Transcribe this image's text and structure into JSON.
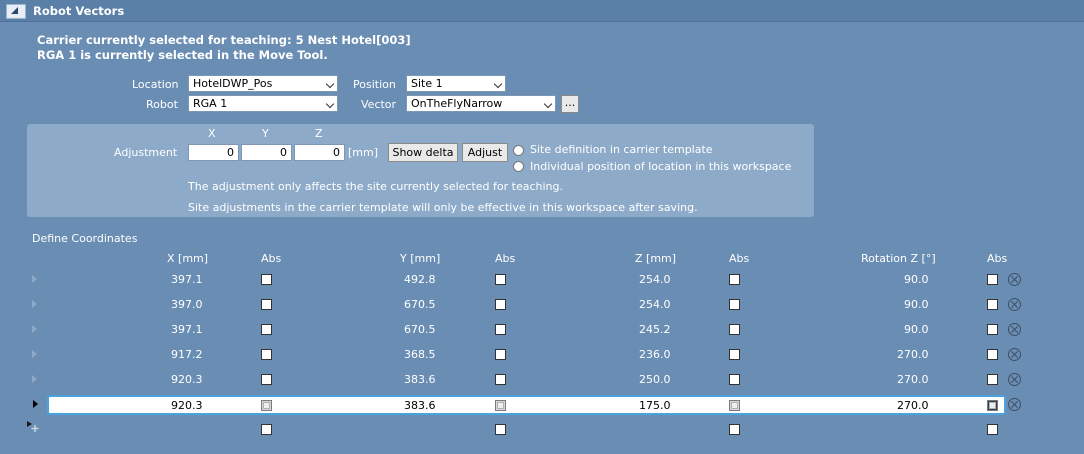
{
  "panel": {
    "title": "Robot Vectors"
  },
  "status": {
    "line1": "Carrier currently selected for teaching: 5 Nest Hotel[003]",
    "line2": "RGA 1 is currently selected in the Move Tool."
  },
  "form": {
    "location_label": "Location",
    "location_value": "HotelDWP_Pos",
    "position_label": "Position",
    "position_value": "Site 1",
    "robot_label": "Robot",
    "robot_value": "RGA 1",
    "vector_label": "Vector",
    "vector_value": "OnTheFlyNarrow",
    "browse_label": "..."
  },
  "adjustment": {
    "label": "Adjustment",
    "x_head": "X",
    "y_head": "Y",
    "z_head": "Z",
    "x_value": "0",
    "y_value": "0",
    "z_value": "0",
    "unit": "[mm]",
    "show_delta_label": "Show delta",
    "adjust_label": "Adjust",
    "radio1_label": "Site definition in carrier template",
    "radio2_label": "Individual position of location in this workspace",
    "note1": "The adjustment only affects the site currently selected for teaching.",
    "note2": "Site adjustments in the carrier template will only be effective in this workspace after saving."
  },
  "coords": {
    "section_label": "Define Coordinates",
    "headers": [
      "X [mm]",
      "Abs",
      "Y [mm]",
      "Abs",
      "Z [mm]",
      "Abs",
      "Rotation Z [°]",
      "Abs"
    ],
    "rows": [
      {
        "x": "397.1",
        "y": "492.8",
        "z": "254.0",
        "rz": "90.0"
      },
      {
        "x": "397.0",
        "y": "670.5",
        "z": "254.0",
        "rz": "90.0"
      },
      {
        "x": "397.1",
        "y": "670.5",
        "z": "245.2",
        "rz": "90.0"
      },
      {
        "x": "917.2",
        "y": "368.5",
        "z": "236.0",
        "rz": "270.0"
      },
      {
        "x": "920.3",
        "y": "383.6",
        "z": "250.0",
        "rz": "270.0"
      },
      {
        "x": "920.3",
        "y": "383.6",
        "z": "175.0",
        "rz": "270.0"
      }
    ]
  },
  "colors": {
    "background": "#6a8db4",
    "selection_border": "#4aa3df",
    "adjust_panel": "#8eaac9"
  }
}
